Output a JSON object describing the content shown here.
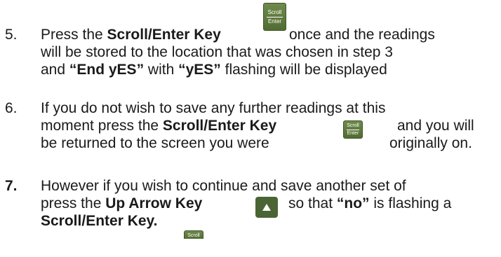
{
  "keys": {
    "scroll": "Scroll",
    "enter": "Enter"
  },
  "steps": [
    {
      "number": "5.",
      "l1_a": "Press the ",
      "l1_b": "Scroll/Enter Key",
      "l1_c": "once and the readings",
      "l2": "will be stored to the location that was chosen in step 3",
      "l3_a": "and ",
      "l3_b": "“End yES”",
      "l3_c": " with ",
      "l3_d": "“yES”",
      "l3_e": " flashing will be displayed"
    },
    {
      "number": "6.",
      "l1": "If you do not wish to save any further readings at this",
      "l2_a": "moment press the ",
      "l2_b": "Scroll/Enter Key",
      "l2_c": "and you will",
      "l3_a": "be returned to the screen you were",
      "l3_b": "originally on."
    },
    {
      "number": "7.",
      "l1": "However if you wish to continue and save another set of",
      "l2_a": "press the ",
      "l2_b": "Up Arrow Key",
      "l2_c": "so that ",
      "l2_d": "“no”",
      "l2_e": " is flashing a",
      "l3": "Scroll/Enter Key."
    }
  ]
}
